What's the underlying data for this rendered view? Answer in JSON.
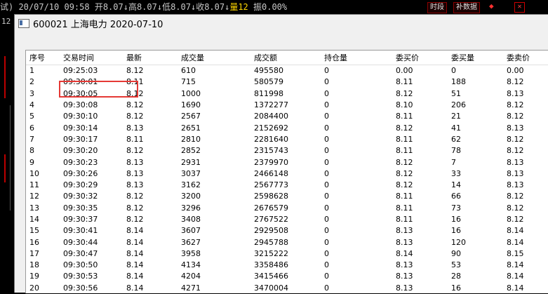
{
  "terminal": {
    "ticker_line": "试) 20/07/10 09:58 开8.07↓高8.07↓低8.07↓收8.07↓",
    "volume_label": "量12",
    "amp_line": "振0.00%",
    "btn_timeslot": "时段",
    "btn_newdata": "补数据",
    "left_label": "12"
  },
  "window": {
    "title": "600021 上海电力 2020-07-10"
  },
  "table": {
    "headers": [
      "序号",
      "交易时间",
      "最新",
      "成交量",
      "成交额",
      "持仓量",
      "委买价",
      "委买量",
      "委卖价"
    ],
    "rows": [
      [
        "1",
        "09:25:03",
        "8.12",
        "610",
        "495580",
        "0",
        "0.00",
        "0",
        "0.00"
      ],
      [
        "2",
        "09:30:01",
        "8.11",
        "715",
        "580579",
        "0",
        "8.11",
        "188",
        "8.12"
      ],
      [
        "3",
        "09:30:05",
        "8.12",
        "1000",
        "811998",
        "0",
        "8.12",
        "51",
        "8.13"
      ],
      [
        "4",
        "09:30:08",
        "8.12",
        "1690",
        "1372277",
        "0",
        "8.10",
        "206",
        "8.12"
      ],
      [
        "5",
        "09:30:10",
        "8.12",
        "2567",
        "2084400",
        "0",
        "8.11",
        "21",
        "8.12"
      ],
      [
        "6",
        "09:30:14",
        "8.13",
        "2651",
        "2152692",
        "0",
        "8.12",
        "41",
        "8.13"
      ],
      [
        "7",
        "09:30:17",
        "8.11",
        "2810",
        "2281640",
        "0",
        "8.11",
        "62",
        "8.12"
      ],
      [
        "8",
        "09:30:20",
        "8.12",
        "2852",
        "2315743",
        "0",
        "8.11",
        "78",
        "8.12"
      ],
      [
        "9",
        "09:30:23",
        "8.13",
        "2931",
        "2379970",
        "0",
        "8.12",
        "7",
        "8.13"
      ],
      [
        "10",
        "09:30:26",
        "8.13",
        "3037",
        "2466148",
        "0",
        "8.12",
        "33",
        "8.13"
      ],
      [
        "11",
        "09:30:29",
        "8.13",
        "3162",
        "2567773",
        "0",
        "8.12",
        "14",
        "8.13"
      ],
      [
        "12",
        "09:30:32",
        "8.12",
        "3200",
        "2598628",
        "0",
        "8.11",
        "66",
        "8.12"
      ],
      [
        "13",
        "09:30:35",
        "8.12",
        "3296",
        "2676579",
        "0",
        "8.11",
        "73",
        "8.12"
      ],
      [
        "14",
        "09:30:37",
        "8.12",
        "3408",
        "2767522",
        "0",
        "8.11",
        "16",
        "8.12"
      ],
      [
        "15",
        "09:30:41",
        "8.14",
        "3607",
        "2929508",
        "0",
        "8.13",
        "16",
        "8.14"
      ],
      [
        "16",
        "09:30:44",
        "8.14",
        "3627",
        "2945788",
        "0",
        "8.13",
        "120",
        "8.14"
      ],
      [
        "17",
        "09:30:47",
        "8.14",
        "3958",
        "3215222",
        "0",
        "8.14",
        "90",
        "8.15"
      ],
      [
        "18",
        "09:30:50",
        "8.14",
        "4134",
        "3358486",
        "0",
        "8.13",
        "53",
        "8.14"
      ],
      [
        "19",
        "09:30:53",
        "8.14",
        "4204",
        "3415466",
        "0",
        "8.13",
        "28",
        "8.14"
      ],
      [
        "20",
        "09:30:56",
        "8.14",
        "4271",
        "3470004",
        "0",
        "8.13",
        "16",
        "8.14"
      ]
    ]
  },
  "colors": {
    "highlight": "#e53935"
  }
}
